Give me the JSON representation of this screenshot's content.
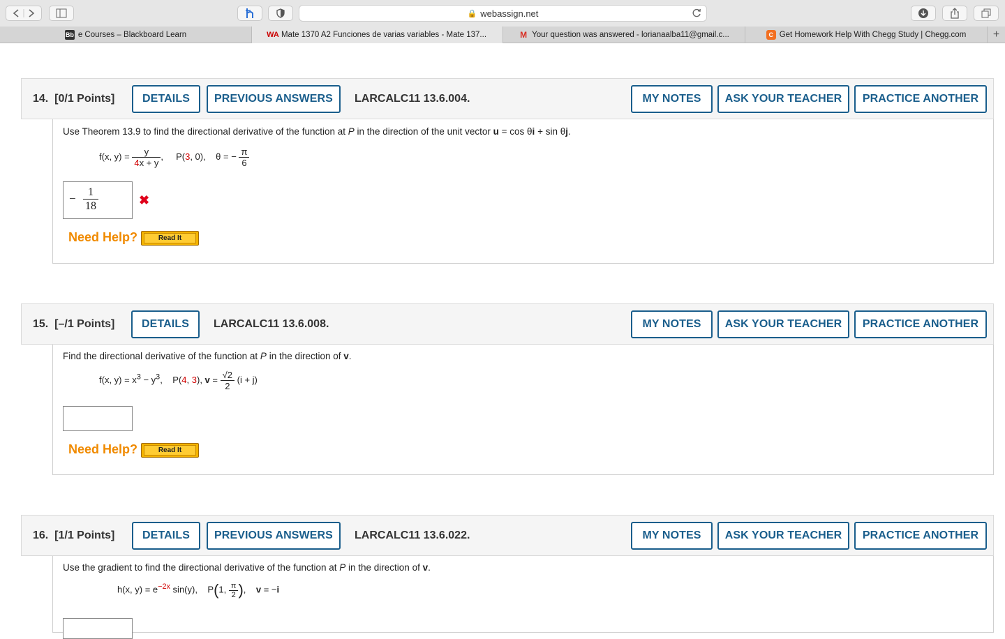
{
  "browser": {
    "url": "webassign.net",
    "tabs": [
      {
        "label": "e Courses – Blackboard Learn",
        "favicon": "blackboard-icon",
        "favicon_text": "Bb"
      },
      {
        "label": "Mate 1370 A2 Funciones de varias variables - Mate 137...",
        "favicon": "webassign-icon",
        "favicon_text": "WA"
      },
      {
        "label": "Your question was answered - lorianaalba11@gmail.c...",
        "favicon": "gmail-icon",
        "favicon_text": "M"
      },
      {
        "label": "Get Homework Help With Chegg Study | Chegg.com",
        "favicon": "chegg-icon",
        "favicon_text": "C"
      }
    ],
    "new_tab": "+"
  },
  "colors": {
    "button_border": "#1a5e8c",
    "need_help": "#f08a00",
    "error_red": "#e0001b",
    "value_red": "#d00000"
  },
  "questions": [
    {
      "number": "14.",
      "points": "[0/1 Points]",
      "details": "DETAILS",
      "previous_answers": "PREVIOUS ANSWERS",
      "code": "LARCALC11 13.6.004.",
      "my_notes": "MY NOTES",
      "ask_teacher": "ASK YOUR TEACHER",
      "practice": "PRACTICE ANOTHER",
      "prompt_a": "Use Theorem 13.9 to find the directional derivative of the function at ",
      "prompt_p": "P",
      "prompt_b": " in the direction of the unit vector ",
      "prompt_u": "u",
      "prompt_c": " = cos θ",
      "prompt_i": "i",
      "prompt_d": " + sin θ",
      "prompt_j": "j",
      "prompt_e": ".",
      "formula": {
        "lhs": "f(x, y) =",
        "num": "y",
        "den_red": "4",
        "den_rest": "x + y",
        "comma": ",",
        "point_a": "P(",
        "point_red": "3",
        "point_b": ", 0),",
        "theta": "θ = −",
        "theta_num": "π",
        "theta_den": "6"
      },
      "answer_sign": "−",
      "answer_num": "1",
      "answer_den": "18",
      "status": "incorrect",
      "status_icon": "✖",
      "need_help": "Need Help?",
      "read_it": "Read It"
    },
    {
      "number": "15.",
      "points": "[–/1 Points]",
      "details": "DETAILS",
      "code": "LARCALC11 13.6.008.",
      "my_notes": "MY NOTES",
      "ask_teacher": "ASK YOUR TEACHER",
      "practice": "PRACTICE ANOTHER",
      "prompt_a": "Find the directional derivative of the function at ",
      "prompt_p": "P",
      "prompt_b": " in the direction of ",
      "prompt_v": "v",
      "prompt_c": ".",
      "formula": {
        "lhs": "f(x, y) = x",
        "exp1": "3",
        "mid": " − y",
        "exp2": "3",
        "comma": ",",
        "point_a": "P(",
        "point_red1": "4",
        "point_sep": ", ",
        "point_red2": "3",
        "point_b": "), ",
        "v": "v",
        "eq": " =",
        "sqrt_num": "√2",
        "sqrt_den": "2",
        "vec": "(i + j)"
      },
      "answer_value": "",
      "need_help": "Need Help?",
      "read_it": "Read It"
    },
    {
      "number": "16.",
      "points": "[1/1 Points]",
      "details": "DETAILS",
      "previous_answers": "PREVIOUS ANSWERS",
      "code": "LARCALC11 13.6.022.",
      "my_notes": "MY NOTES",
      "ask_teacher": "ASK YOUR TEACHER",
      "practice": "PRACTICE ANOTHER",
      "prompt_a": "Use the gradient to find the directional derivative of the function at ",
      "prompt_p": "P",
      "prompt_b": " in the direction of ",
      "prompt_v": "v",
      "prompt_c": ".",
      "formula": {
        "lhs": "h(x, y) = e",
        "exp": "−2x",
        "rest": " sin(y),",
        "point_a": "P",
        "point_one": "1,",
        "pi_num": "π",
        "pi_den": "2",
        "comma": ",",
        "v": "v",
        "v_rest": " = −",
        "i": "i"
      }
    }
  ]
}
